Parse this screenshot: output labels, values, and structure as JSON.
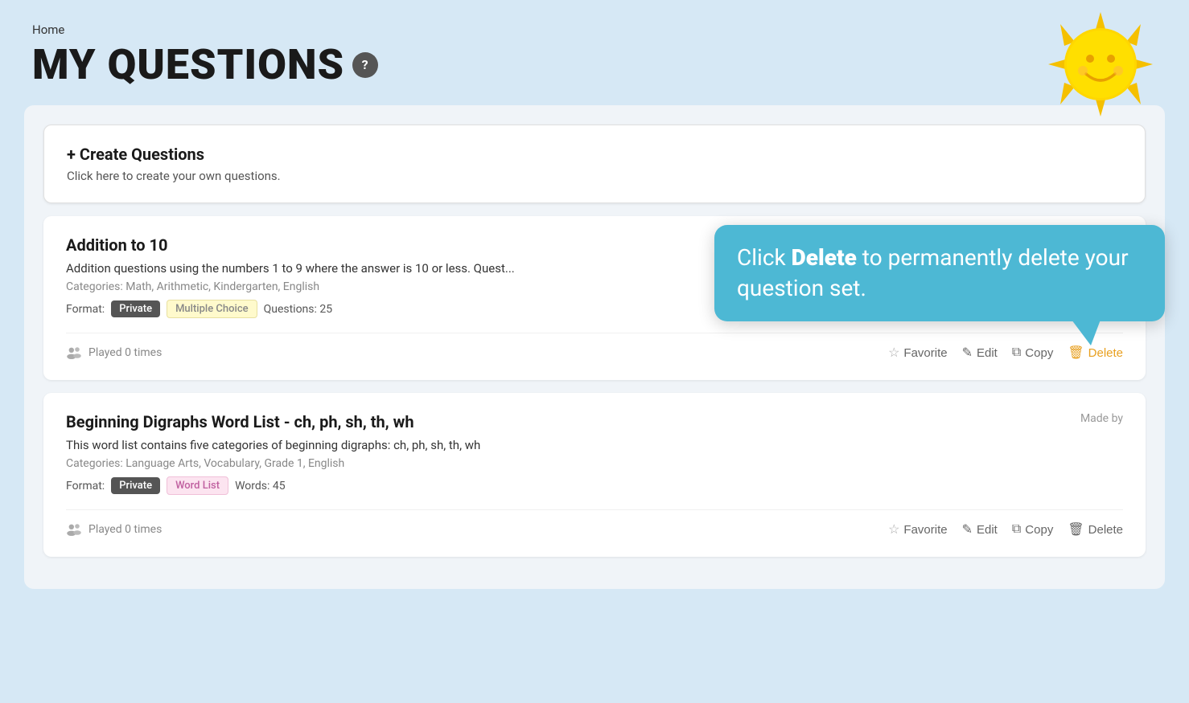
{
  "header": {
    "breadcrumb": "Home",
    "title": "MY QUESTIONS",
    "help_icon": "?"
  },
  "tooltip": {
    "text_normal": "Click ",
    "text_bold": "Delete",
    "text_end": " to permanently delete your question set."
  },
  "create_card": {
    "title": "+ Create Questions",
    "description": "Click here to create your own questions."
  },
  "question_cards": [
    {
      "title": "Addition to 10",
      "description": "Addition questions using the numbers 1 to 9 where the answer is 10 or less. Quest...",
      "categories": "Categories: Math, Arithmetic, Kindergarten, English",
      "format_label": "Format:",
      "badge_private": "Private",
      "badge_format": "Multiple Choice",
      "questions_count": "Questions: 25",
      "played_times": "Played 0 times",
      "actions": {
        "favorite": "Favorite",
        "edit": "Edit",
        "copy": "Copy",
        "delete": "Delete"
      },
      "made_by": null
    },
    {
      "title": "Beginning Digraphs Word List - ch, ph, sh, th, wh",
      "description": "This word list contains five categories of beginning digraphs: ch, ph, sh, th, wh",
      "categories": "Categories: Language Arts, Vocabulary, Grade 1, English",
      "format_label": "Format:",
      "badge_private": "Private",
      "badge_format": "Word List",
      "questions_count": "Words: 45",
      "played_times": "Played 0 times",
      "actions": {
        "favorite": "Favorite",
        "edit": "Edit",
        "copy": "Copy",
        "delete": "Delete"
      },
      "made_by": "Made by"
    }
  ],
  "colors": {
    "page_bg": "#d6e8f5",
    "tooltip_bg": "#4db8d4",
    "delete_color": "#e8a020",
    "badge_private_bg": "#555555",
    "badge_mc_bg": "#fffacc",
    "badge_wl_bg": "#fce4f0"
  }
}
